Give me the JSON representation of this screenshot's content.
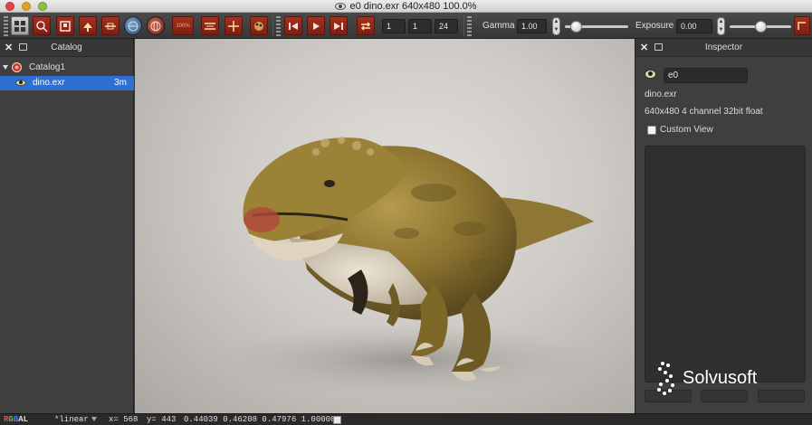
{
  "window": {
    "title": "e0 dino.exr 640x480 100.0%"
  },
  "toolbar": {
    "zoom_badge": "100%",
    "frame_start": "1",
    "frame_current": "1",
    "frame_end": "24",
    "gamma_label": "Gamma",
    "gamma_value": "1.00",
    "exposure_label": "Exposure",
    "exposure_value": "0.00",
    "gamma_slider_level": 0.17,
    "exposure_slider_level": 0.5
  },
  "catalog": {
    "title": "Catalog",
    "items": [
      {
        "label": "Catalog1",
        "size": ""
      },
      {
        "label": "dino.exr",
        "size": "3m"
      }
    ]
  },
  "inspector": {
    "title": "Inspector",
    "name_value": "e0",
    "filename": "dino.exr",
    "format": "640x480 4 channel 32bit float",
    "custom_view_label": "Custom View",
    "watermark": "Solvusoft"
  },
  "status": {
    "channels": [
      "R",
      "G",
      "B",
      "A",
      "L"
    ],
    "lut": "*linear",
    "x": "x= 568",
    "y": "y= 443",
    "pixel": "0.44039 0.46208 0.47976 1.00000"
  },
  "colors": {
    "selection": "#2d6fd3",
    "toolbar_red": "#a5301f",
    "channel_r": "#e85050",
    "channel_g": "#60c060",
    "channel_b": "#5080e8"
  }
}
